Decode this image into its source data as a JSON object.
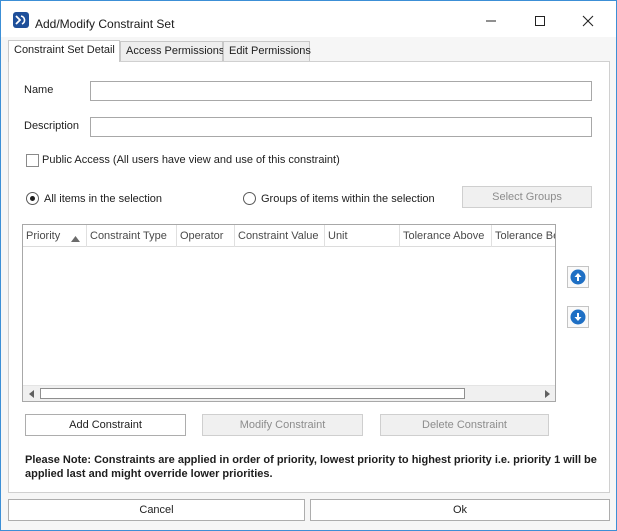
{
  "window": {
    "title": "Add/Modify Constraint Set"
  },
  "tabs": [
    {
      "label": "Constraint Set Detail",
      "active": true
    },
    {
      "label": "Access Permissions",
      "active": false
    },
    {
      "label": "Edit Permissions",
      "active": false
    }
  ],
  "form": {
    "name_label": "Name",
    "name_value": "",
    "description_label": "Description",
    "description_value": "",
    "public_access_label": "Public Access (All users have view and use of this constraint)",
    "public_access_checked": false
  },
  "selection": {
    "all_items_label": "All items in the selection",
    "all_items_checked": true,
    "groups_label": "Groups of items within the selection",
    "groups_checked": false,
    "select_groups_label": "Select Groups"
  },
  "grid": {
    "columns": [
      "Priority",
      "Constraint Type",
      "Operator",
      "Constraint Value",
      "Unit",
      "Tolerance Above",
      "Tolerance Be"
    ],
    "rows": []
  },
  "actions": {
    "add_label": "Add Constraint",
    "modify_label": "Modify Constraint",
    "delete_label": "Delete Constraint"
  },
  "note": "Please Note: Constraints are applied in order of priority, lowest priority to highest priority i.e. priority 1 will be applied last and might override lower priorities.",
  "footer": {
    "cancel_label": "Cancel",
    "ok_label": "Ok"
  },
  "colors": {
    "accent": "#1e6fc4",
    "window_border": "#3c8fd6"
  },
  "icons": {
    "app": "app-logo-icon",
    "minimize": "minimize-icon",
    "maximize": "maximize-icon",
    "close": "close-icon",
    "move_up": "arrow-up-circle-icon",
    "move_down": "arrow-down-circle-icon"
  }
}
